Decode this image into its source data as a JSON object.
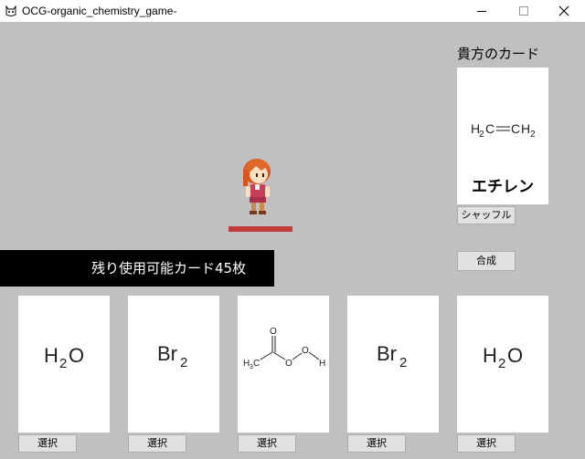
{
  "window": {
    "title": "OCG-organic_chemistry_game-",
    "icon": "cat-app-icon",
    "controls": [
      "minimize-icon",
      "maximize-icon",
      "close-icon"
    ]
  },
  "player": {
    "section_label": "貴方のカード",
    "card": {
      "formula_left": "H",
      "formula_left_sub": "2",
      "bond": "C═C",
      "formula_right": "H",
      "formula_right_sub": "2",
      "name": "エチレン"
    },
    "shuffle_label": "シャッフル",
    "synthesize_label": "合成"
  },
  "status": {
    "remaining_text": "残り使用可能カード45枚"
  },
  "character": {
    "sprite": "red-haired-girl-sprite"
  },
  "hand": [
    {
      "formula": "H",
      "sub": "2",
      "tail": "O",
      "select_label": "選択"
    },
    {
      "formula": "Br",
      "sub": "2",
      "tail": "",
      "select_label": "選択"
    },
    {
      "structure": "peracetic-acid",
      "labels": {
        "h3c": "H",
        "h3c_sub": "3",
        "c": "C",
        "o_top": "O",
        "o1": "O",
        "o2": "O",
        "h": "H"
      },
      "select_label": "選択"
    },
    {
      "formula": "Br",
      "sub": "2",
      "tail": "",
      "select_label": "選択"
    },
    {
      "formula": "H",
      "sub": "2",
      "tail": "O",
      "select_label": "選択"
    }
  ],
  "colors": {
    "background": "#c0c0c0",
    "hp_bar": "#c33a3a",
    "status_bar": "#000000"
  }
}
